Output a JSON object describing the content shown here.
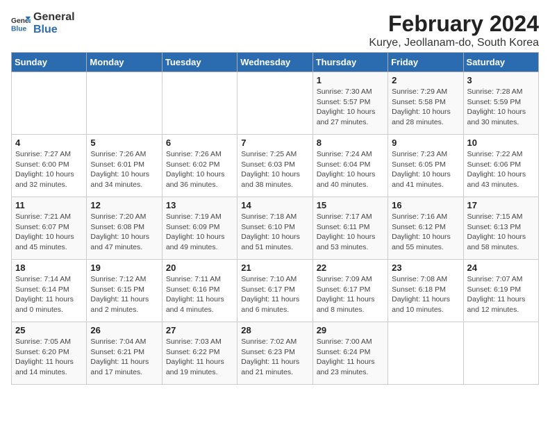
{
  "header": {
    "logo_line1": "General",
    "logo_line2": "Blue",
    "month": "February 2024",
    "location": "Kurye, Jeollanam-do, South Korea"
  },
  "days_of_week": [
    "Sunday",
    "Monday",
    "Tuesday",
    "Wednesday",
    "Thursday",
    "Friday",
    "Saturday"
  ],
  "weeks": [
    [
      {
        "day": "",
        "info": ""
      },
      {
        "day": "",
        "info": ""
      },
      {
        "day": "",
        "info": ""
      },
      {
        "day": "",
        "info": ""
      },
      {
        "day": "1",
        "info": "Sunrise: 7:30 AM\nSunset: 5:57 PM\nDaylight: 10 hours\nand 27 minutes."
      },
      {
        "day": "2",
        "info": "Sunrise: 7:29 AM\nSunset: 5:58 PM\nDaylight: 10 hours\nand 28 minutes."
      },
      {
        "day": "3",
        "info": "Sunrise: 7:28 AM\nSunset: 5:59 PM\nDaylight: 10 hours\nand 30 minutes."
      }
    ],
    [
      {
        "day": "4",
        "info": "Sunrise: 7:27 AM\nSunset: 6:00 PM\nDaylight: 10 hours\nand 32 minutes."
      },
      {
        "day": "5",
        "info": "Sunrise: 7:26 AM\nSunset: 6:01 PM\nDaylight: 10 hours\nand 34 minutes."
      },
      {
        "day": "6",
        "info": "Sunrise: 7:26 AM\nSunset: 6:02 PM\nDaylight: 10 hours\nand 36 minutes."
      },
      {
        "day": "7",
        "info": "Sunrise: 7:25 AM\nSunset: 6:03 PM\nDaylight: 10 hours\nand 38 minutes."
      },
      {
        "day": "8",
        "info": "Sunrise: 7:24 AM\nSunset: 6:04 PM\nDaylight: 10 hours\nand 40 minutes."
      },
      {
        "day": "9",
        "info": "Sunrise: 7:23 AM\nSunset: 6:05 PM\nDaylight: 10 hours\nand 41 minutes."
      },
      {
        "day": "10",
        "info": "Sunrise: 7:22 AM\nSunset: 6:06 PM\nDaylight: 10 hours\nand 43 minutes."
      }
    ],
    [
      {
        "day": "11",
        "info": "Sunrise: 7:21 AM\nSunset: 6:07 PM\nDaylight: 10 hours\nand 45 minutes."
      },
      {
        "day": "12",
        "info": "Sunrise: 7:20 AM\nSunset: 6:08 PM\nDaylight: 10 hours\nand 47 minutes."
      },
      {
        "day": "13",
        "info": "Sunrise: 7:19 AM\nSunset: 6:09 PM\nDaylight: 10 hours\nand 49 minutes."
      },
      {
        "day": "14",
        "info": "Sunrise: 7:18 AM\nSunset: 6:10 PM\nDaylight: 10 hours\nand 51 minutes."
      },
      {
        "day": "15",
        "info": "Sunrise: 7:17 AM\nSunset: 6:11 PM\nDaylight: 10 hours\nand 53 minutes."
      },
      {
        "day": "16",
        "info": "Sunrise: 7:16 AM\nSunset: 6:12 PM\nDaylight: 10 hours\nand 55 minutes."
      },
      {
        "day": "17",
        "info": "Sunrise: 7:15 AM\nSunset: 6:13 PM\nDaylight: 10 hours\nand 58 minutes."
      }
    ],
    [
      {
        "day": "18",
        "info": "Sunrise: 7:14 AM\nSunset: 6:14 PM\nDaylight: 11 hours\nand 0 minutes."
      },
      {
        "day": "19",
        "info": "Sunrise: 7:12 AM\nSunset: 6:15 PM\nDaylight: 11 hours\nand 2 minutes."
      },
      {
        "day": "20",
        "info": "Sunrise: 7:11 AM\nSunset: 6:16 PM\nDaylight: 11 hours\nand 4 minutes."
      },
      {
        "day": "21",
        "info": "Sunrise: 7:10 AM\nSunset: 6:17 PM\nDaylight: 11 hours\nand 6 minutes."
      },
      {
        "day": "22",
        "info": "Sunrise: 7:09 AM\nSunset: 6:17 PM\nDaylight: 11 hours\nand 8 minutes."
      },
      {
        "day": "23",
        "info": "Sunrise: 7:08 AM\nSunset: 6:18 PM\nDaylight: 11 hours\nand 10 minutes."
      },
      {
        "day": "24",
        "info": "Sunrise: 7:07 AM\nSunset: 6:19 PM\nDaylight: 11 hours\nand 12 minutes."
      }
    ],
    [
      {
        "day": "25",
        "info": "Sunrise: 7:05 AM\nSunset: 6:20 PM\nDaylight: 11 hours\nand 14 minutes."
      },
      {
        "day": "26",
        "info": "Sunrise: 7:04 AM\nSunset: 6:21 PM\nDaylight: 11 hours\nand 17 minutes."
      },
      {
        "day": "27",
        "info": "Sunrise: 7:03 AM\nSunset: 6:22 PM\nDaylight: 11 hours\nand 19 minutes."
      },
      {
        "day": "28",
        "info": "Sunrise: 7:02 AM\nSunset: 6:23 PM\nDaylight: 11 hours\nand 21 minutes."
      },
      {
        "day": "29",
        "info": "Sunrise: 7:00 AM\nSunset: 6:24 PM\nDaylight: 11 hours\nand 23 minutes."
      },
      {
        "day": "",
        "info": ""
      },
      {
        "day": "",
        "info": ""
      }
    ]
  ]
}
